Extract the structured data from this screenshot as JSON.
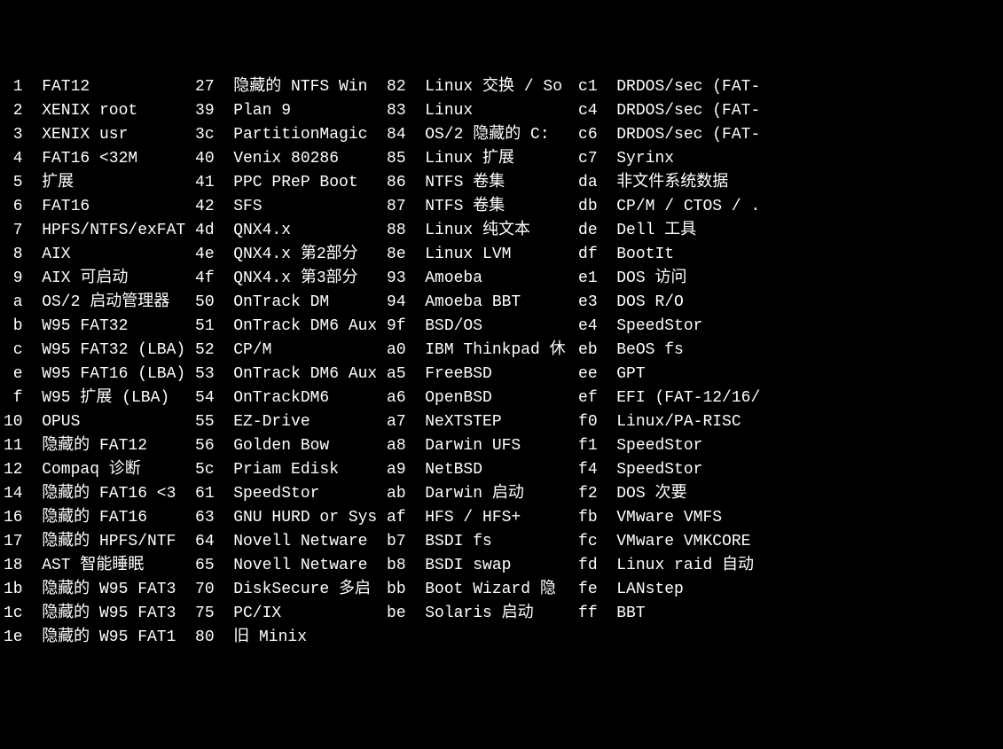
{
  "rows": [
    [
      {
        "code": "1",
        "name": "FAT12"
      },
      {
        "code": "27",
        "name": "隐藏的 NTFS Win"
      },
      {
        "code": "82",
        "name": "Linux 交换 / So"
      },
      {
        "code": "c1",
        "name": "DRDOS/sec (FAT-"
      }
    ],
    [
      {
        "code": "2",
        "name": "XENIX root"
      },
      {
        "code": "39",
        "name": "Plan 9"
      },
      {
        "code": "83",
        "name": "Linux"
      },
      {
        "code": "c4",
        "name": "DRDOS/sec (FAT-"
      }
    ],
    [
      {
        "code": "3",
        "name": "XENIX usr"
      },
      {
        "code": "3c",
        "name": "PartitionMagic"
      },
      {
        "code": "84",
        "name": "OS/2 隐藏的 C:"
      },
      {
        "code": "c6",
        "name": "DRDOS/sec (FAT-"
      }
    ],
    [
      {
        "code": "4",
        "name": "FAT16 <32M"
      },
      {
        "code": "40",
        "name": "Venix 80286"
      },
      {
        "code": "85",
        "name": "Linux 扩展"
      },
      {
        "code": "c7",
        "name": "Syrinx"
      }
    ],
    [
      {
        "code": "5",
        "name": "扩展"
      },
      {
        "code": "41",
        "name": "PPC PReP Boot"
      },
      {
        "code": "86",
        "name": "NTFS 卷集"
      },
      {
        "code": "da",
        "name": "非文件系统数据"
      }
    ],
    [
      {
        "code": "6",
        "name": "FAT16"
      },
      {
        "code": "42",
        "name": "SFS"
      },
      {
        "code": "87",
        "name": "NTFS 卷集"
      },
      {
        "code": "db",
        "name": "CP/M / CTOS / ."
      }
    ],
    [
      {
        "code": "7",
        "name": "HPFS/NTFS/exFAT"
      },
      {
        "code": "4d",
        "name": "QNX4.x"
      },
      {
        "code": "88",
        "name": "Linux 纯文本"
      },
      {
        "code": "de",
        "name": "Dell 工具"
      }
    ],
    [
      {
        "code": "8",
        "name": "AIX"
      },
      {
        "code": "4e",
        "name": "QNX4.x 第2部分"
      },
      {
        "code": "8e",
        "name": "Linux LVM"
      },
      {
        "code": "df",
        "name": "BootIt"
      }
    ],
    [
      {
        "code": "9",
        "name": "AIX 可启动"
      },
      {
        "code": "4f",
        "name": "QNX4.x 第3部分"
      },
      {
        "code": "93",
        "name": "Amoeba"
      },
      {
        "code": "e1",
        "name": "DOS 访问"
      }
    ],
    [
      {
        "code": "a",
        "name": "OS/2 启动管理器"
      },
      {
        "code": "50",
        "name": "OnTrack DM"
      },
      {
        "code": "94",
        "name": "Amoeba BBT"
      },
      {
        "code": "e3",
        "name": "DOS R/O"
      }
    ],
    [
      {
        "code": "b",
        "name": "W95 FAT32"
      },
      {
        "code": "51",
        "name": "OnTrack DM6 Aux"
      },
      {
        "code": "9f",
        "name": "BSD/OS"
      },
      {
        "code": "e4",
        "name": "SpeedStor"
      }
    ],
    [
      {
        "code": "c",
        "name": "W95 FAT32 (LBA)"
      },
      {
        "code": "52",
        "name": "CP/M"
      },
      {
        "code": "a0",
        "name": "IBM Thinkpad 休"
      },
      {
        "code": "eb",
        "name": "BeOS fs"
      }
    ],
    [
      {
        "code": "e",
        "name": "W95 FAT16 (LBA)"
      },
      {
        "code": "53",
        "name": "OnTrack DM6 Aux"
      },
      {
        "code": "a5",
        "name": "FreeBSD"
      },
      {
        "code": "ee",
        "name": "GPT"
      }
    ],
    [
      {
        "code": "f",
        "name": "W95 扩展 (LBA)"
      },
      {
        "code": "54",
        "name": "OnTrackDM6"
      },
      {
        "code": "a6",
        "name": "OpenBSD"
      },
      {
        "code": "ef",
        "name": "EFI (FAT-12/16/"
      }
    ],
    [
      {
        "code": "10",
        "name": "OPUS"
      },
      {
        "code": "55",
        "name": "EZ-Drive"
      },
      {
        "code": "a7",
        "name": "NeXTSTEP"
      },
      {
        "code": "f0",
        "name": "Linux/PA-RISC"
      }
    ],
    [
      {
        "code": "11",
        "name": "隐藏的 FAT12"
      },
      {
        "code": "56",
        "name": "Golden Bow"
      },
      {
        "code": "a8",
        "name": "Darwin UFS"
      },
      {
        "code": "f1",
        "name": "SpeedStor"
      }
    ],
    [
      {
        "code": "12",
        "name": "Compaq 诊断"
      },
      {
        "code": "5c",
        "name": "Priam Edisk"
      },
      {
        "code": "a9",
        "name": "NetBSD"
      },
      {
        "code": "f4",
        "name": "SpeedStor"
      }
    ],
    [
      {
        "code": "14",
        "name": "隐藏的 FAT16 <3"
      },
      {
        "code": "61",
        "name": "SpeedStor"
      },
      {
        "code": "ab",
        "name": "Darwin 启动"
      },
      {
        "code": "f2",
        "name": "DOS 次要"
      }
    ],
    [
      {
        "code": "16",
        "name": "隐藏的 FAT16"
      },
      {
        "code": "63",
        "name": "GNU HURD or Sys"
      },
      {
        "code": "af",
        "name": "HFS / HFS+"
      },
      {
        "code": "fb",
        "name": "VMware VMFS"
      }
    ],
    [
      {
        "code": "17",
        "name": "隐藏的 HPFS/NTF"
      },
      {
        "code": "64",
        "name": "Novell Netware"
      },
      {
        "code": "b7",
        "name": "BSDI fs"
      },
      {
        "code": "fc",
        "name": "VMware VMKCORE"
      }
    ],
    [
      {
        "code": "18",
        "name": "AST 智能睡眠"
      },
      {
        "code": "65",
        "name": "Novell Netware"
      },
      {
        "code": "b8",
        "name": "BSDI swap"
      },
      {
        "code": "fd",
        "name": "Linux raid 自动"
      }
    ],
    [
      {
        "code": "1b",
        "name": "隐藏的 W95 FAT3"
      },
      {
        "code": "70",
        "name": "DiskSecure 多启"
      },
      {
        "code": "bb",
        "name": "Boot Wizard 隐"
      },
      {
        "code": "fe",
        "name": "LANstep"
      }
    ],
    [
      {
        "code": "1c",
        "name": "隐藏的 W95 FAT3"
      },
      {
        "code": "75",
        "name": "PC/IX"
      },
      {
        "code": "be",
        "name": "Solaris 启动"
      },
      {
        "code": "ff",
        "name": "BBT"
      }
    ],
    [
      {
        "code": "1e",
        "name": "隐藏的 W95 FAT1"
      },
      {
        "code": "80",
        "name": "旧 Minix"
      }
    ]
  ]
}
